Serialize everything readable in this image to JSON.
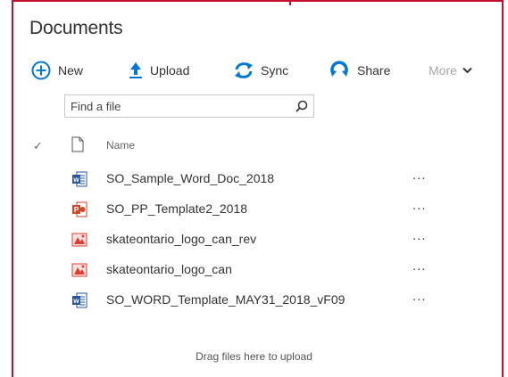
{
  "library": {
    "title": "Documents"
  },
  "commands": {
    "new": "New",
    "upload": "Upload",
    "sync": "Sync",
    "share": "Share",
    "more": "More"
  },
  "search": {
    "placeholder": "Find a file"
  },
  "columns": {
    "name": "Name"
  },
  "files": [
    {
      "name": "SO_Sample_Word_Doc_2018",
      "type": "word",
      "icon": "word-doc-icon"
    },
    {
      "name": "SO_PP_Template2_2018",
      "type": "powerpoint",
      "icon": "powerpoint-doc-icon"
    },
    {
      "name": "skateontario_logo_can_rev",
      "type": "image",
      "icon": "image-file-icon"
    },
    {
      "name": "skateontario_logo_can",
      "type": "image",
      "icon": "image-file-icon"
    },
    {
      "name": "SO_WORD_Template_MAY31_2018_vF09",
      "type": "word",
      "icon": "word-doc-icon"
    }
  ],
  "row_actions": {
    "ellipsis": "..."
  },
  "footer": {
    "drop_hint": "Drag files here to upload"
  },
  "colors": {
    "accent": "#0078d4",
    "word": "#2b579a",
    "powerpoint": "#d24726",
    "image": "#e03c31",
    "frame": "#c8102e"
  }
}
